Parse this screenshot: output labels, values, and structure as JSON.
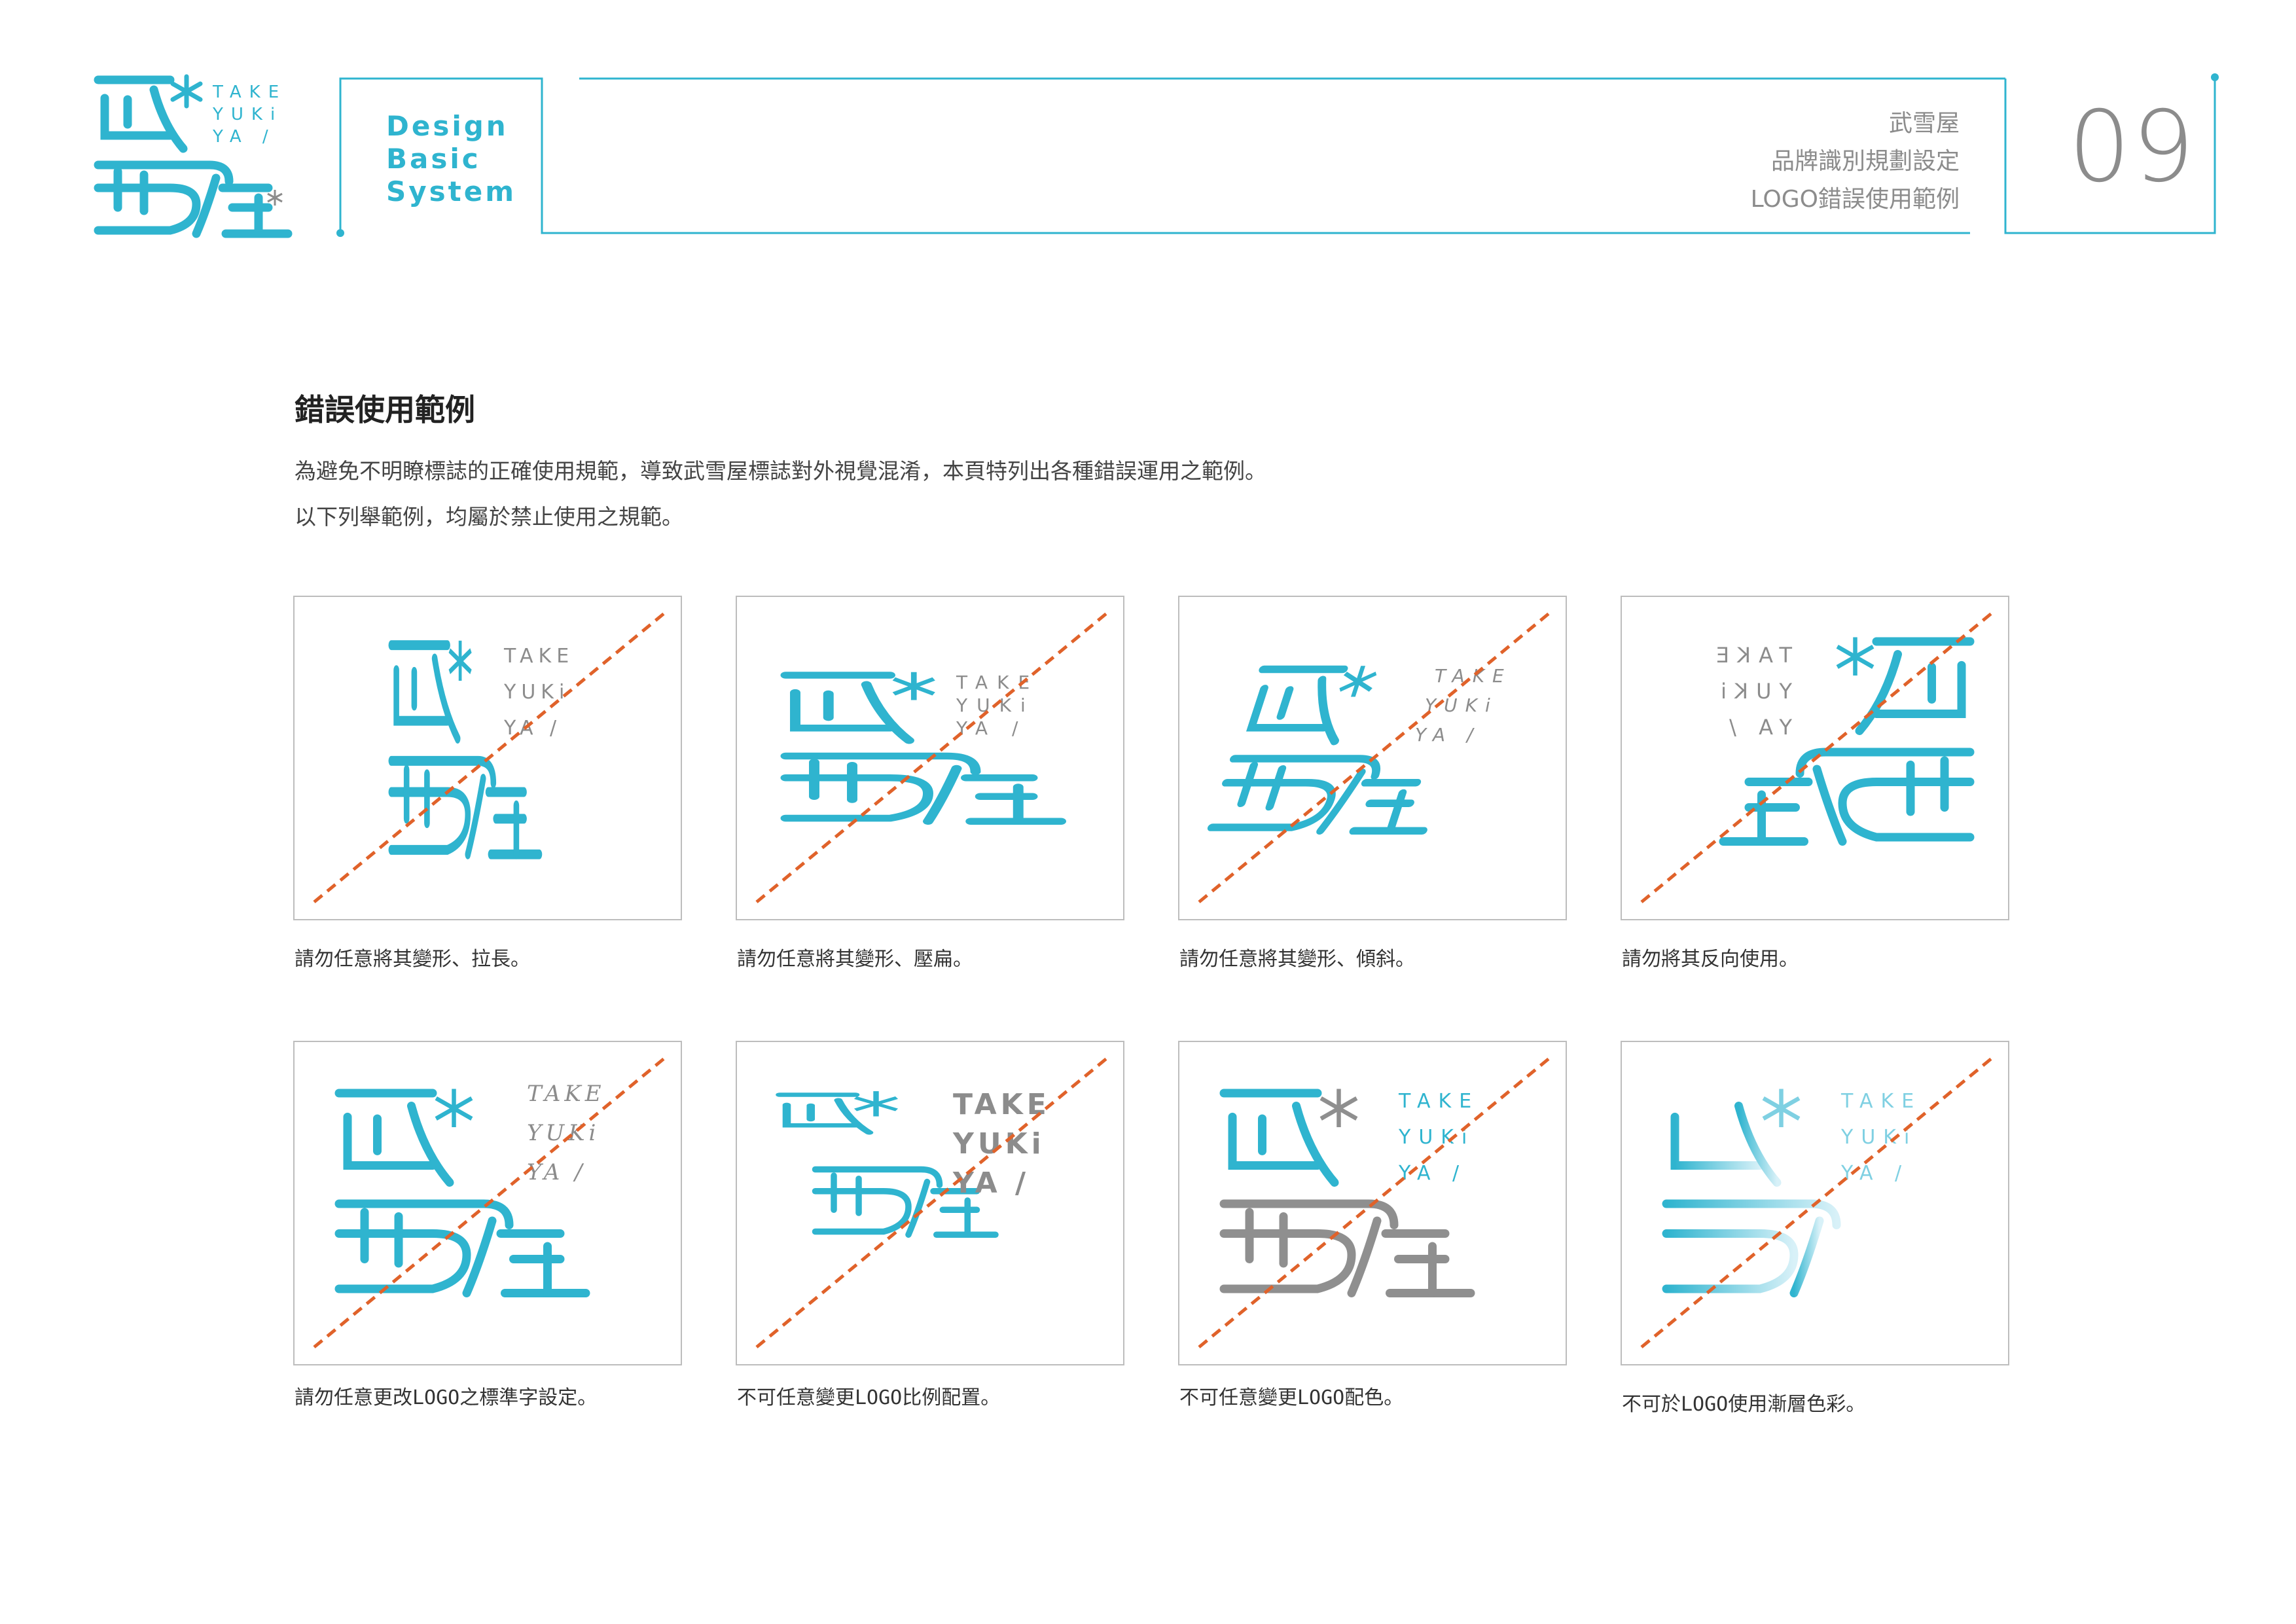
{
  "brand": {
    "logo_cjk": "武雪屋",
    "logo_latin": [
      "TAKE",
      "YUKi",
      "YA /"
    ]
  },
  "header": {
    "system_label": [
      "Design",
      "Basic",
      "System"
    ],
    "lines": [
      "武雪屋",
      "品牌識別規劃設定",
      "LOGO錯誤使用範例"
    ],
    "page_number": "09"
  },
  "section": {
    "title": "錯誤使用範例",
    "description": [
      "為避免不明瞭標誌的正確使用規範，導致武雪屋標誌對外視覺混淆，本頁特列出各種錯誤運用之範例。",
      "以下列舉範例，均屬於禁止使用之規範。"
    ]
  },
  "examples": [
    {
      "caption": "請勿任意將其變形、拉長。",
      "variant": "stretch-vertical"
    },
    {
      "caption": "請勿任意將其變形、壓扁。",
      "variant": "squash"
    },
    {
      "caption": "請勿任意將其變形、傾斜。",
      "variant": "skew"
    },
    {
      "caption": "請勿將其反向使用。",
      "variant": "mirror"
    },
    {
      "caption": "請勿任意更改LOGO之標準字設定。",
      "variant": "font-change"
    },
    {
      "caption": "不可任意變更LOGO比例配置。",
      "variant": "ratio-change"
    },
    {
      "caption": "不可任意變更LOGO配色。",
      "variant": "recolor"
    },
    {
      "caption": "不可於LOGO使用漸層色彩。",
      "variant": "gradient"
    }
  ],
  "colors": {
    "brand_teal": "#2fb4cf",
    "gray_text": "#8c8c8c",
    "logo_gray": "#8f8f8f",
    "strike_orange": "#e0622a",
    "border": "#bdbdbd"
  }
}
